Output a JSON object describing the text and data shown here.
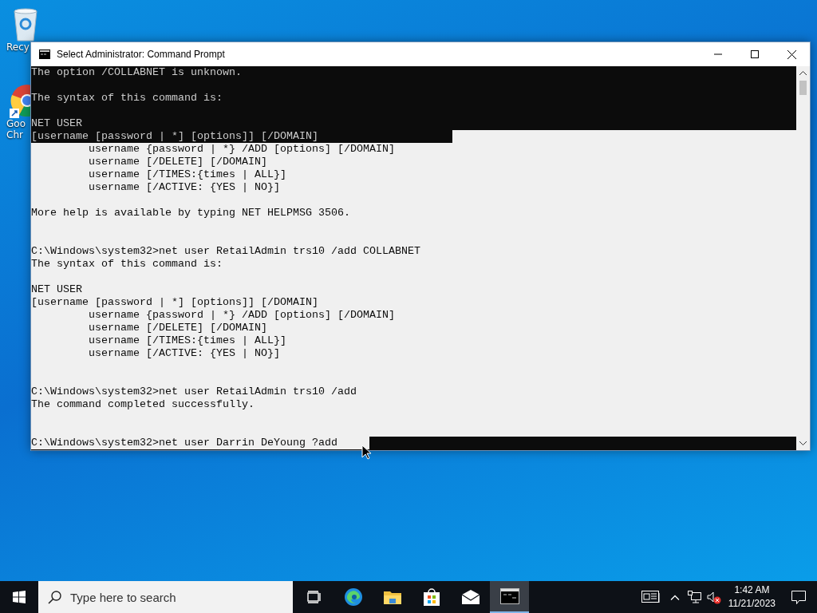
{
  "desktop_icons": [
    {
      "kind": "recycle-bin",
      "label": [
        "Recy"
      ]
    },
    {
      "kind": "chrome",
      "label": [
        "Goo",
        "Chr"
      ]
    }
  ],
  "window": {
    "title": "Select Administrator: Command Prompt"
  },
  "console": {
    "lines": [
      {
        "text": "The option /COLLABNET is unknown.",
        "selected": false
      },
      {
        "selected": false
      },
      {
        "text": "The syntax of this command is:",
        "selected": false
      },
      {
        "selected": false
      },
      {
        "text": "NET USER",
        "selected": false
      },
      {
        "text": "[username [password | *] [options]] [/DOMAIN]",
        "selected": false,
        "kind": "selection-start"
      },
      {
        "text": "         username {password | *} /ADD [options] [/DOMAIN]",
        "selected": true
      },
      {
        "text": "         username [/DELETE] [/DOMAIN]",
        "selected": true
      },
      {
        "text": "         username [/TIMES:{times | ALL}]",
        "selected": true
      },
      {
        "text": "         username [/ACTIVE: {YES | NO}]",
        "selected": true
      },
      {
        "selected": true
      },
      {
        "text": "More help is available by typing NET HELPMSG 3506.",
        "selected": true
      },
      {
        "selected": true
      },
      {
        "selected": true
      },
      {
        "text": "C:\\Windows\\system32>net user RetailAdmin trs10 /add COLLABNET",
        "selected": true
      },
      {
        "text": "The syntax of this command is:",
        "selected": true
      },
      {
        "selected": true
      },
      {
        "text": "NET USER",
        "selected": true
      },
      {
        "text": "[username [password | *] [options]] [/DOMAIN]",
        "selected": true
      },
      {
        "text": "         username {password | *} /ADD [options] [/DOMAIN]",
        "selected": true
      },
      {
        "text": "         username [/DELETE] [/DOMAIN]",
        "selected": true
      },
      {
        "text": "         username [/TIMES:{times | ALL}]",
        "selected": true
      },
      {
        "text": "         username [/ACTIVE: {YES | NO}]",
        "selected": true
      },
      {
        "selected": true
      },
      {
        "selected": true
      },
      {
        "text": "C:\\Windows\\system32>net user RetailAdmin trs10 /add",
        "selected": true
      },
      {
        "text": "The command completed successfully.",
        "selected": true
      },
      {
        "selected": true
      },
      {
        "selected": true
      },
      {
        "text": "C:\\Windows\\system32>net user Darrin DeYoung ?add",
        "selected": true,
        "kind": "selection-end"
      }
    ]
  },
  "taskbar": {
    "search": {
      "placeholder": "Type here to search"
    },
    "apps": [
      {
        "kind": "task-view",
        "selected": false
      },
      {
        "kind": "edge",
        "selected": false
      },
      {
        "kind": "explorer",
        "selected": false
      },
      {
        "kind": "store",
        "selected": false
      },
      {
        "kind": "mail",
        "selected": false
      },
      {
        "kind": "cmd",
        "selected": true
      }
    ],
    "tray": {
      "time": "1:42 AM",
      "date": "11/21/2023"
    }
  }
}
